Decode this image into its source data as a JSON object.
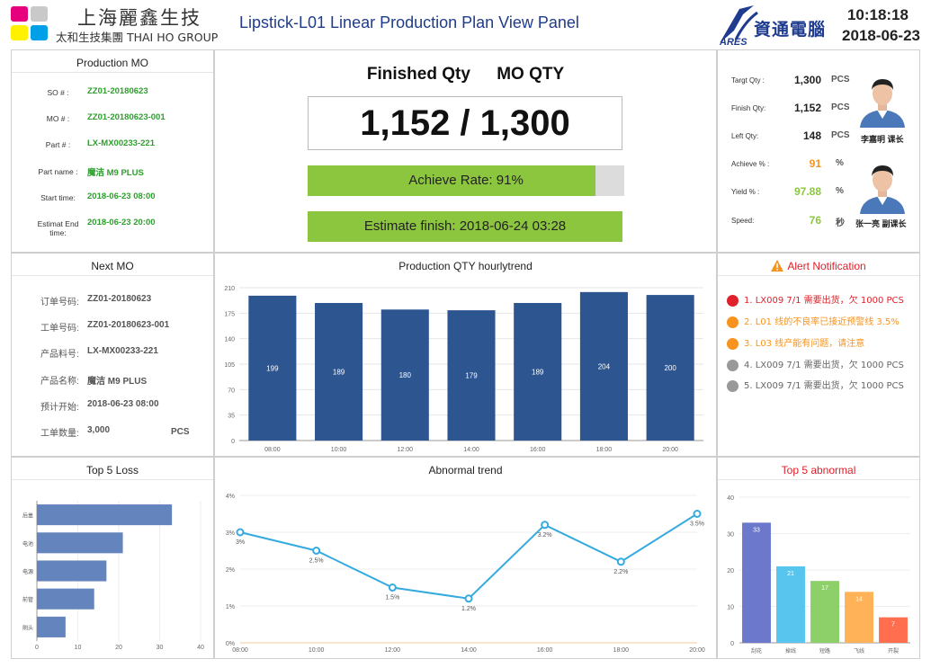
{
  "header": {
    "company_cn": "上海麗鑫生技",
    "company_en": "太和生技集團 THAI HO GROUP",
    "title": "Lipstick-L01 Linear Production Plan View Panel",
    "ares_text": "ARES",
    "ares_cn": "資通電腦",
    "time": "10:18:18",
    "date": "2018-06-23",
    "logo_colors": [
      "#e6007e",
      "#ffffff",
      "#00a0e9",
      "#fff100",
      "#c9c9c9"
    ]
  },
  "production_mo": {
    "title": "Production MO",
    "fields": [
      {
        "label": "SO # :",
        "value": "ZZ01-20180623"
      },
      {
        "label": "MO # :",
        "value": "ZZ01-20180623-001"
      },
      {
        "label": "Part # :",
        "value": "LX-MX00233-221"
      },
      {
        "label": "Part name :",
        "value": "魔洁 M9 PLUS"
      },
      {
        "label": "Start time:",
        "value": "2018-06-23 08:00"
      },
      {
        "label": "Estimat End time:",
        "value": "2018-06-23 20:00"
      }
    ]
  },
  "summary": {
    "finished_label": "Finished Qty",
    "mo_label": "MO QTY",
    "qty_display": "1,152 / 1,300",
    "achieve_text": "Achieve Rate: 91%",
    "achieve_fraction": 0.91,
    "estimate_text": "Estimate finish: 2018-06-24 03:28"
  },
  "stats": {
    "rows": [
      {
        "label": "Targt Qty :",
        "value": "1,300",
        "unit": "PCS",
        "color": "#222222"
      },
      {
        "label": "Finish Qty:",
        "value": "1,152",
        "unit": "PCS",
        "color": "#222222"
      },
      {
        "label": "Left  Qty:",
        "value": "148",
        "unit": "PCS",
        "color": "#222222"
      },
      {
        "label": "Achieve % :",
        "value": "91",
        "unit": "%",
        "color": "#f7931e"
      },
      {
        "label": "Yield  % :",
        "value": "97.88",
        "unit": "%",
        "color": "#8cc63e"
      },
      {
        "label": "Speed:",
        "value": "76",
        "unit": "秒",
        "color": "#8cc63e"
      }
    ],
    "person1": "李嘉明 课长",
    "person2": "张一亮 副课长"
  },
  "next_mo": {
    "title": "Next MO",
    "fields": [
      {
        "label": "订单号码:",
        "value": "ZZ01-20180623"
      },
      {
        "label": "工单号码:",
        "value": "ZZ01-20180623-001"
      },
      {
        "label": "产品料号:",
        "value": "LX-MX00233-221"
      },
      {
        "label": "产品名称:",
        "value": "魔洁 M9 PLUS"
      },
      {
        "label": "预计开始:",
        "value": "2018-06-23 08:00"
      },
      {
        "label": "工单数量:",
        "value": "3,000"
      }
    ],
    "unit": "PCS"
  },
  "hourly": {
    "title": "Production QTY  hourlytrend"
  },
  "alerts": {
    "title": "Alert Notification",
    "items": [
      {
        "text": "1.  LX009  7/1 需要出货，欠 1000 PCS",
        "dot": "#e0202a",
        "color": "#e0202a"
      },
      {
        "text": "2.  L01 线的不良率已接近预警线 3.5%",
        "dot": "#f7931e",
        "color": "#f7931e"
      },
      {
        "text": "3. L03 线产能有问题，请注意",
        "dot": "#f7931e",
        "color": "#f7931e"
      },
      {
        "text": "4.  LX009  7/1 需要出货，欠 1000 PCS",
        "dot": "#999999",
        "color": "#666666"
      },
      {
        "text": "5.  LX009  7/1 需要出货，欠 1000 PCS",
        "dot": "#999999",
        "color": "#666666"
      }
    ]
  },
  "loss": {
    "title": "Top 5 Loss"
  },
  "abnormal_trend": {
    "title": "Abnormal trend"
  },
  "top5_abnormal": {
    "title": "Top 5 abnormal"
  },
  "chart_data": [
    {
      "type": "bar",
      "categories": [
        "08:00",
        "10:00",
        "12:00",
        "14:00",
        "16:00",
        "18:00",
        "20:00"
      ],
      "values": [
        199,
        189,
        180,
        179,
        189,
        204,
        200
      ],
      "ylim": [
        0,
        210
      ],
      "yticks": [
        0,
        35,
        70,
        105,
        140,
        175,
        210
      ],
      "color": "#2d5590"
    },
    {
      "type": "bar",
      "orientation": "horizontal",
      "categories": [
        "后盖",
        "电池",
        "电源",
        "前管",
        "刷头"
      ],
      "values": [
        33,
        21,
        17,
        14,
        7
      ],
      "xlim": [
        0,
        40
      ],
      "xticks": [
        0,
        10,
        20,
        30,
        40
      ],
      "color": "#6384bc"
    },
    {
      "type": "line",
      "x": [
        "08:00",
        "10:00",
        "12:00",
        "14:00",
        "16:00",
        "18:00",
        "20:00"
      ],
      "values": [
        3.0,
        2.5,
        1.5,
        1.2,
        3.2,
        2.2,
        3.5
      ],
      "labels": [
        "3%",
        "2.5%",
        "1.5%",
        "1.2%",
        "3.2%",
        "2.2%",
        "3.5%"
      ],
      "ylim": [
        0,
        4
      ],
      "yticks": [
        "0%",
        "1%",
        "2%",
        "3%",
        "4%"
      ],
      "color": "#35aadf"
    },
    {
      "type": "bar",
      "categories": [
        "刮花",
        "掉线",
        "短路",
        "飞线",
        "开裂"
      ],
      "values": [
        33,
        21,
        17,
        14,
        7
      ],
      "ylim": [
        0,
        40
      ],
      "yticks": [
        0,
        10,
        20,
        30,
        40
      ],
      "colors": [
        "#6c78cc",
        "#57c5ee",
        "#8dd069",
        "#ffb257",
        "#ff6f4f"
      ]
    }
  ]
}
